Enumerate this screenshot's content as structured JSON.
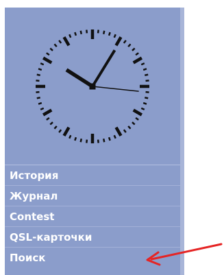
{
  "clock": {
    "hour": 10,
    "minute": 5,
    "second": 16,
    "face_color": "#8b9dcb",
    "mark_color": "#111111"
  },
  "menu": {
    "items": [
      {
        "label": "История",
        "name": "menu-item-history"
      },
      {
        "label": "Журнал",
        "name": "menu-item-journal"
      },
      {
        "label": "Contest",
        "name": "menu-item-contest"
      },
      {
        "label": "QSL-карточки",
        "name": "menu-item-qsl-cards"
      },
      {
        "label": "Поиск",
        "name": "menu-item-search"
      }
    ]
  },
  "annotation": {
    "arrow_color": "#e52424",
    "icon": "red-arrow-icon"
  }
}
